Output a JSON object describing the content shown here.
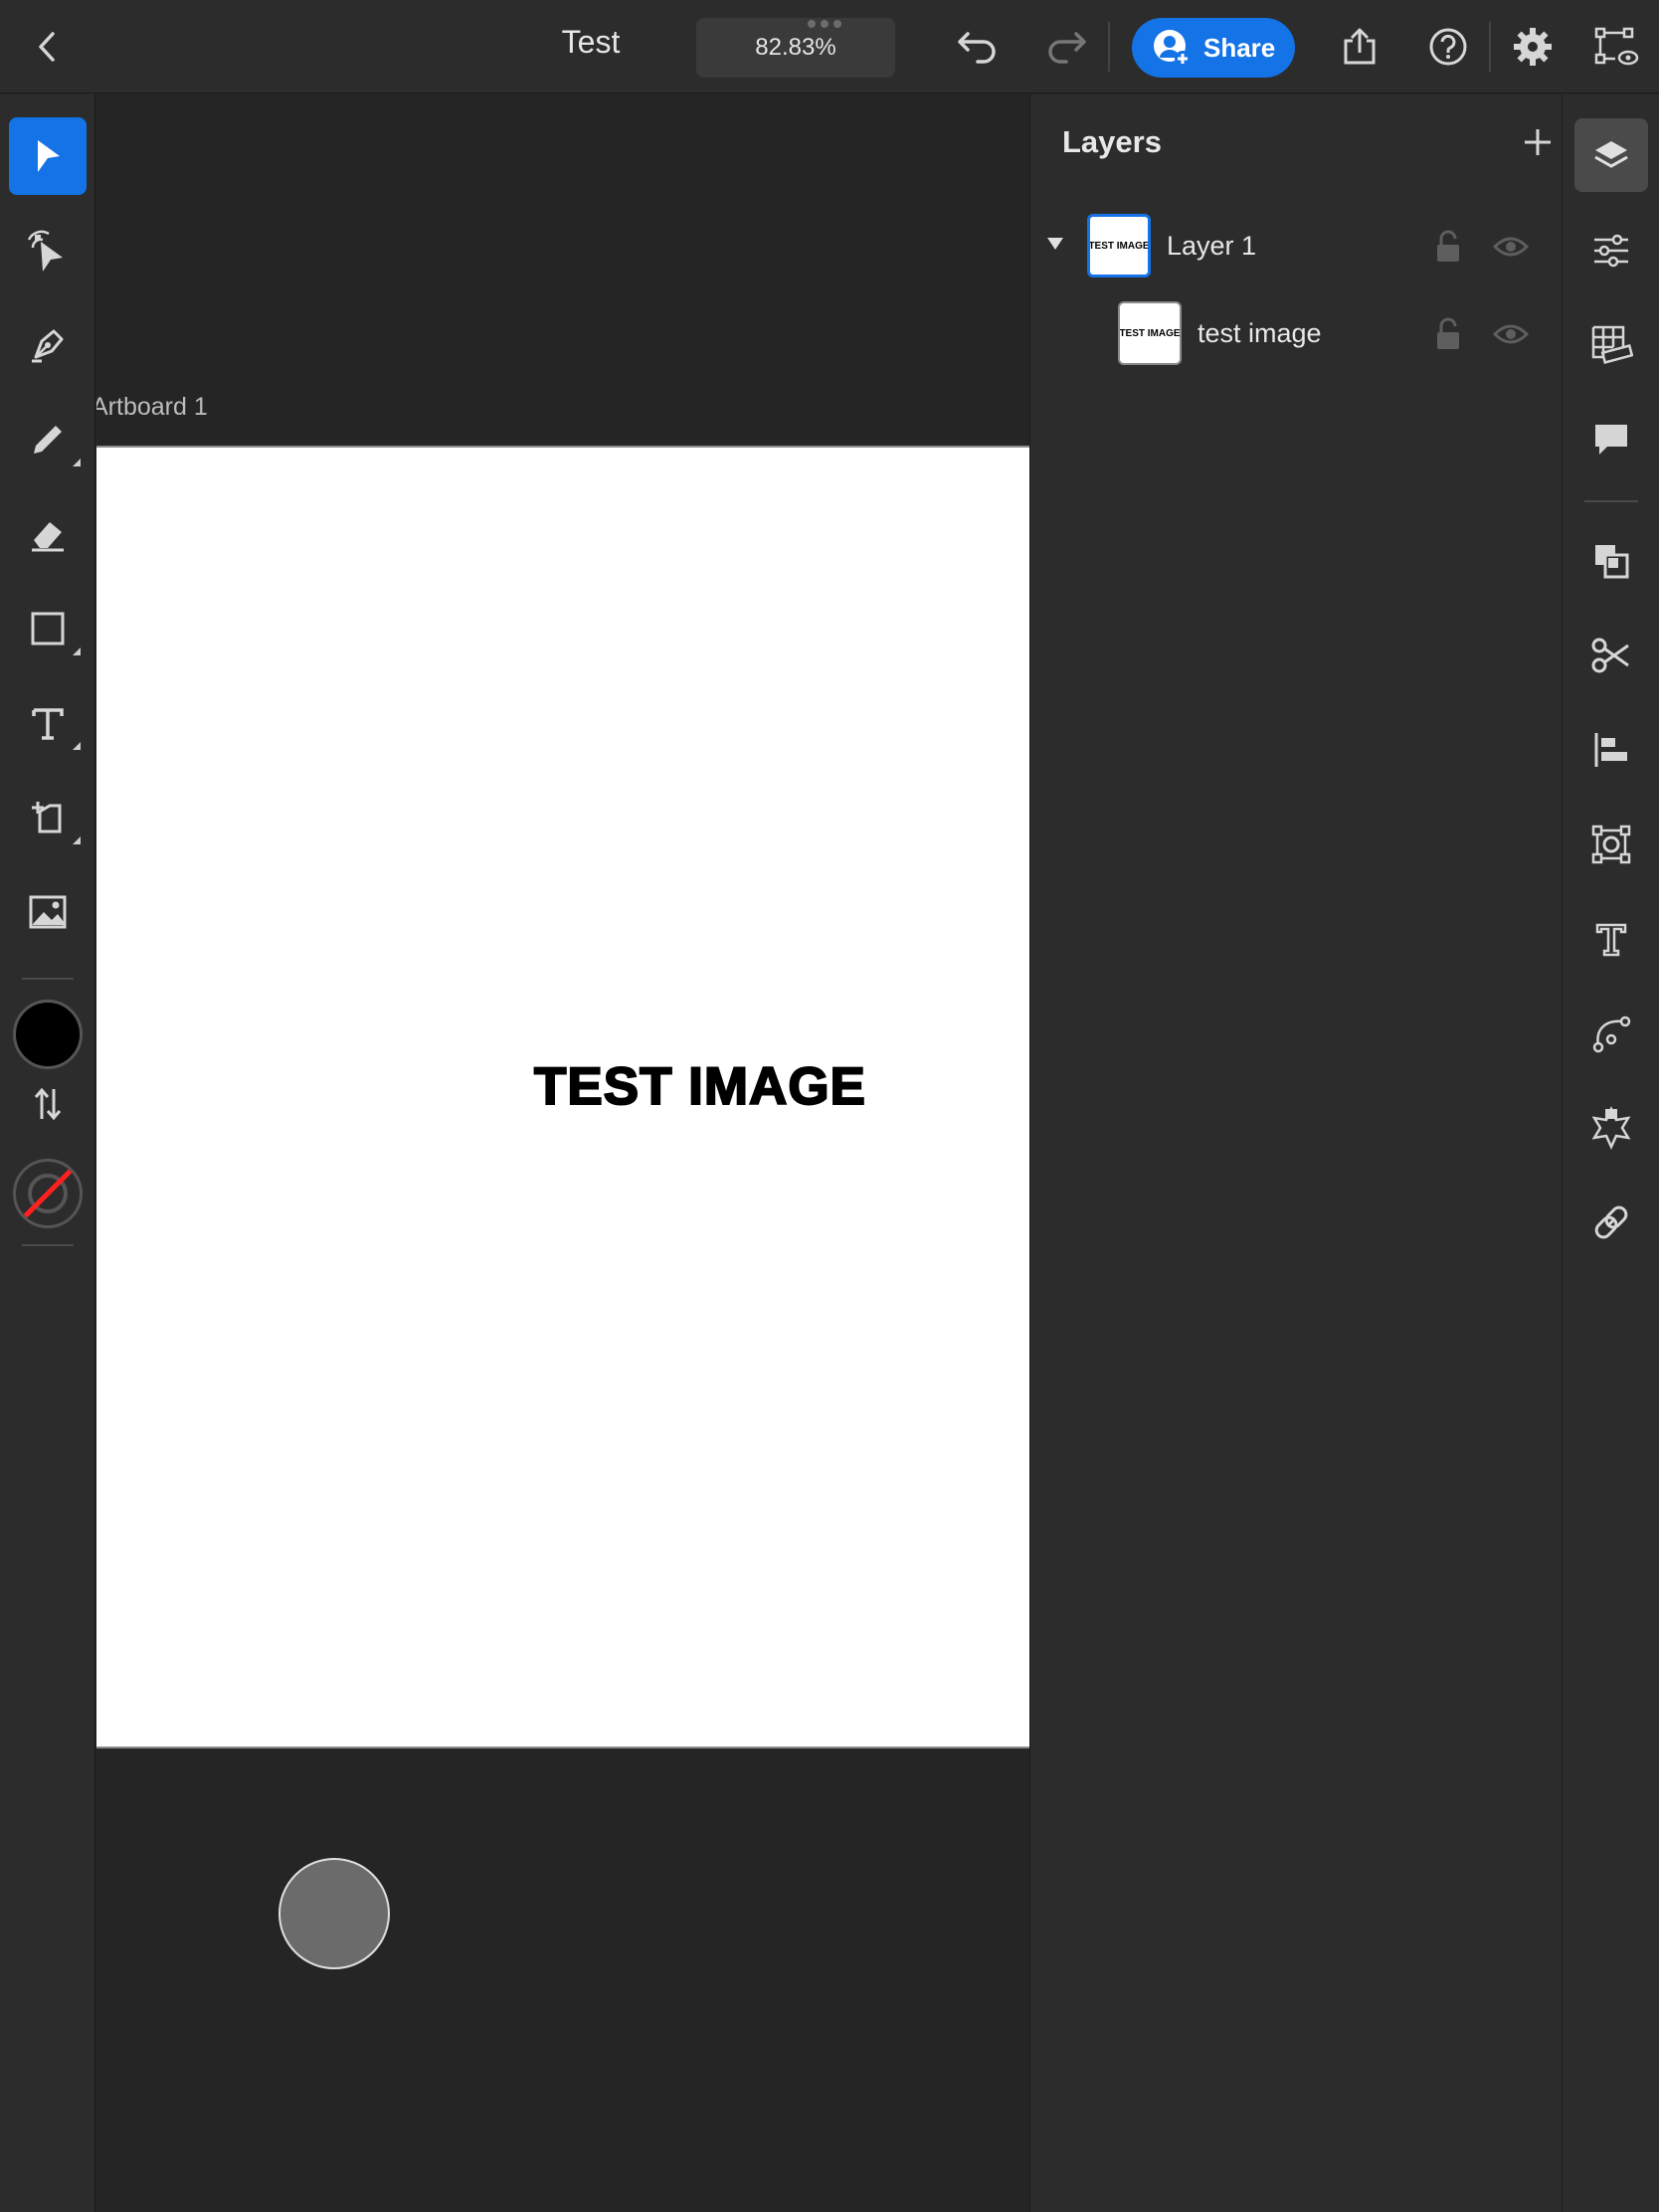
{
  "header": {
    "document_title": "Test",
    "zoom": "82.83%",
    "share_label": "Share"
  },
  "canvas": {
    "artboard_label": "Artboard 1",
    "artboard_text": "TEST IMAGE"
  },
  "layers_panel": {
    "title": "Layers",
    "layers": [
      {
        "name": "Layer 1",
        "thumb_text": "TEST IMAGE",
        "expanded": true,
        "selected": true
      },
      {
        "name": "test image",
        "thumb_text": "TEST IMAGE",
        "selected": false
      }
    ]
  },
  "colors": {
    "accent": "#1473e6",
    "fill": "#000000",
    "stroke": "none"
  },
  "left_tools": [
    "selection-tool",
    "direct-selection-tool",
    "pen-tool",
    "pencil-tool",
    "eraser-tool",
    "rectangle-tool",
    "type-tool",
    "transform-tool",
    "image-tool"
  ],
  "right_rail": [
    "layers",
    "properties",
    "swatches-grid",
    "comments",
    "arrange",
    "shape-builder",
    "align",
    "repeat",
    "glyphs",
    "path",
    "effects",
    "links"
  ]
}
